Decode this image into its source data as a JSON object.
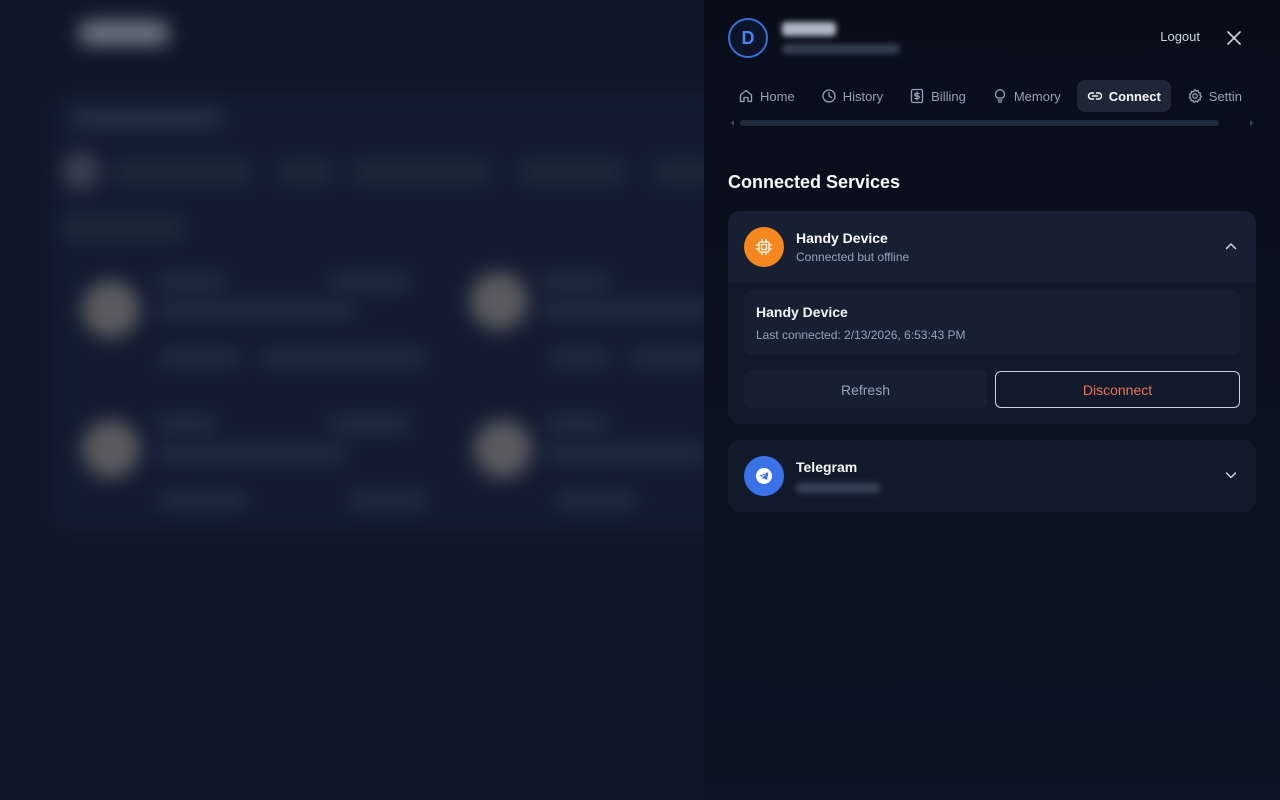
{
  "user": {
    "initial": "D"
  },
  "header": {
    "logout_label": "Logout"
  },
  "tabs": [
    {
      "label": "Home",
      "icon": "home-icon",
      "active": false
    },
    {
      "label": "History",
      "icon": "clock-icon",
      "active": false
    },
    {
      "label": "Billing",
      "icon": "dollar-icon",
      "active": false
    },
    {
      "label": "Memory",
      "icon": "lightbulb-icon",
      "active": false
    },
    {
      "label": "Connect",
      "icon": "link-icon",
      "active": true
    },
    {
      "label": "Settin",
      "icon": "gear-icon",
      "active": false
    }
  ],
  "tab_scroll": {
    "thumb_fraction": 0.95
  },
  "connected": {
    "title": "Connected Services",
    "services": [
      {
        "name": "Handy Device",
        "status": "Connected but offline",
        "icon": "chip-icon",
        "icon_color": "#f5871f",
        "expanded": true,
        "detail_title": "Handy Device",
        "detail_sub": "Last connected: 2/13/2026, 6:53:43 PM",
        "refresh_label": "Refresh",
        "disconnect_label": "Disconnect"
      },
      {
        "name": "Telegram",
        "icon": "telegram-icon",
        "icon_color": "#3b72e8",
        "expanded": false
      }
    ]
  },
  "colors": {
    "accent": "#3b6fd8",
    "danger": "#f0725b",
    "panel_bg": "#080d1a"
  }
}
